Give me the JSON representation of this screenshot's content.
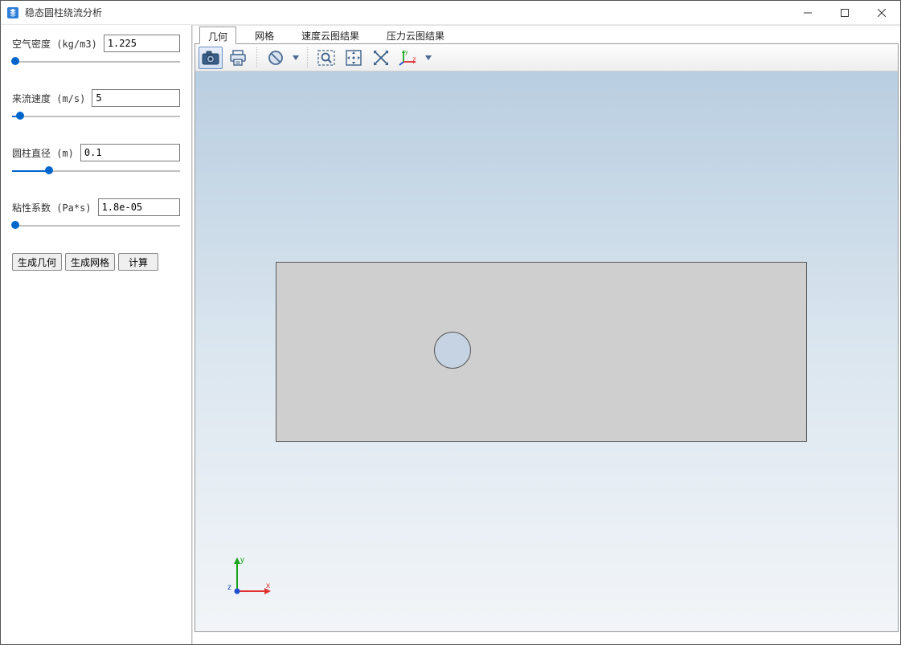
{
  "window": {
    "title": "稳态圆柱绕流分析"
  },
  "params": {
    "air_density": {
      "label": "空气密度 (kg/m3)",
      "value": "1.225",
      "slider_pct": 2
    },
    "inflow_velocity": {
      "label": "来流速度 (m/s)",
      "value": "5",
      "slider_pct": 5
    },
    "cylinder_diameter": {
      "label": "圆柱直径 (m)",
      "value": "0.1",
      "slider_pct": 22
    },
    "viscosity": {
      "label": "粘性系数 (Pa*s)",
      "value": "1.8e-05",
      "slider_pct": 2
    }
  },
  "buttons": {
    "generate_geometry": "生成几何",
    "generate_mesh": "生成网格",
    "compute": "计算"
  },
  "tabs": {
    "geometry": "几何",
    "mesh": "网格",
    "velocity_contour": "速度云图结果",
    "pressure_contour": "压力云图结果",
    "active": "geometry"
  },
  "toolbar": {
    "screenshot": "screenshot",
    "print": "print",
    "block": "block",
    "zoom_box": "zoom-box",
    "pan": "pan",
    "fit": "fit",
    "axes": "axes"
  },
  "axes_labels": {
    "x": "x",
    "y": "y",
    "z": "z"
  }
}
